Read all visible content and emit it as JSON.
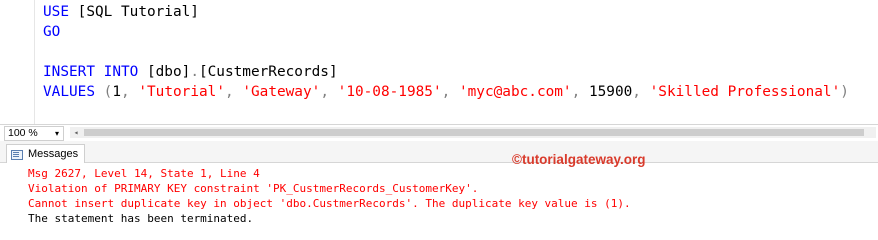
{
  "editor": {
    "line1": {
      "kw": "USE",
      "ident": "[SQL Tutorial]"
    },
    "line2": {
      "kw": "GO"
    },
    "line4": {
      "kw1": "INSERT",
      "kw2": "INTO",
      "schema": "[dbo]",
      "dot": ".",
      "table": "[CustmerRecords]"
    },
    "line5": {
      "kw": "VALUES",
      "open": "(",
      "n1": "1",
      "s1": "'Tutorial'",
      "s2": "'Gateway'",
      "s3": "'10-08-1985'",
      "s4": "'myc@abc.com'",
      "n2": "15900",
      "s5": "'Skilled Professional'",
      "close": ")",
      "comma": ","
    }
  },
  "statusbar": {
    "zoom": "100 %",
    "zoom_arrow": "▾",
    "scroll_left": "◂"
  },
  "results": {
    "tab_label": "Messages",
    "messages": [
      "Msg 2627, Level 14, State 1, Line 4",
      "Violation of PRIMARY KEY constraint 'PK_CustmerRecords_CustomerKey'.",
      "Cannot insert duplicate key in object 'dbo.CustmerRecords'. The duplicate key value is (1).",
      "The statement has been terminated."
    ],
    "watermark": "©tutorialgateway.org"
  },
  "colors": {
    "keyword": "#0000ff",
    "string": "#ff0000",
    "error": "#ff0000",
    "watermark": "#d93a2b"
  }
}
